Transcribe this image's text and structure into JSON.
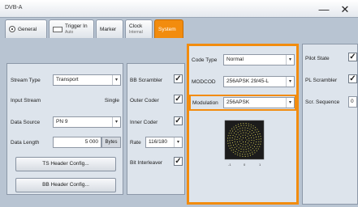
{
  "window": {
    "title": "DVB-A",
    "minimize_label": "—",
    "close_label": "✕"
  },
  "tabs": [
    {
      "label": "General",
      "sub": ""
    },
    {
      "label": "Trigger In",
      "sub": "Auto"
    },
    {
      "label": "Marker",
      "sub": ""
    },
    {
      "label": "Clock",
      "sub": "Internal"
    },
    {
      "label": "System",
      "sub": ""
    }
  ],
  "left_panel": {
    "stream_type": {
      "label": "Stream Type",
      "value": "Transport"
    },
    "input_stream": {
      "label": "Input Stream",
      "value": "Single"
    },
    "data_source": {
      "label": "Data Source",
      "value": "PN 9"
    },
    "data_length": {
      "label": "Data Length",
      "value": "5 000",
      "unit": "Bytes"
    },
    "ts_header_button": "TS Header Config...",
    "bb_header_button": "BB Header Config..."
  },
  "coder_panel": {
    "bb_scrambler": {
      "label": "BB Scrambler",
      "checked": true
    },
    "outer_coder": {
      "label": "Outer Coder",
      "checked": true
    },
    "inner_coder": {
      "label": "Inner Coder",
      "checked": true
    },
    "rate": {
      "label": "Rate",
      "value": "116/180"
    },
    "bit_interleaver": {
      "label": "Bit Interleaver",
      "checked": true
    }
  },
  "modulation_panel": {
    "code_type": {
      "label": "Code Type",
      "value": "Normal"
    },
    "modcod": {
      "label": "MODCOD",
      "value": "256APSK 29/45-L"
    },
    "modulation": {
      "label": "Modulation",
      "value": "256APSK"
    },
    "constellation_ticks": [
      "-1",
      "0",
      "1"
    ]
  },
  "right_panel": {
    "pilot_state": {
      "label": "Pilot State",
      "checked": true
    },
    "pl_scrambler": {
      "label": "PL Scrambler",
      "checked": true
    },
    "scr_sequence": {
      "label": "Scr. Sequence",
      "value": "0"
    }
  },
  "check_glyph": "✓",
  "dropdown_glyph": "▾",
  "colors": {
    "accent": "#f28c0e",
    "panel": "#dde4ec",
    "background": "#b8c4d2"
  }
}
